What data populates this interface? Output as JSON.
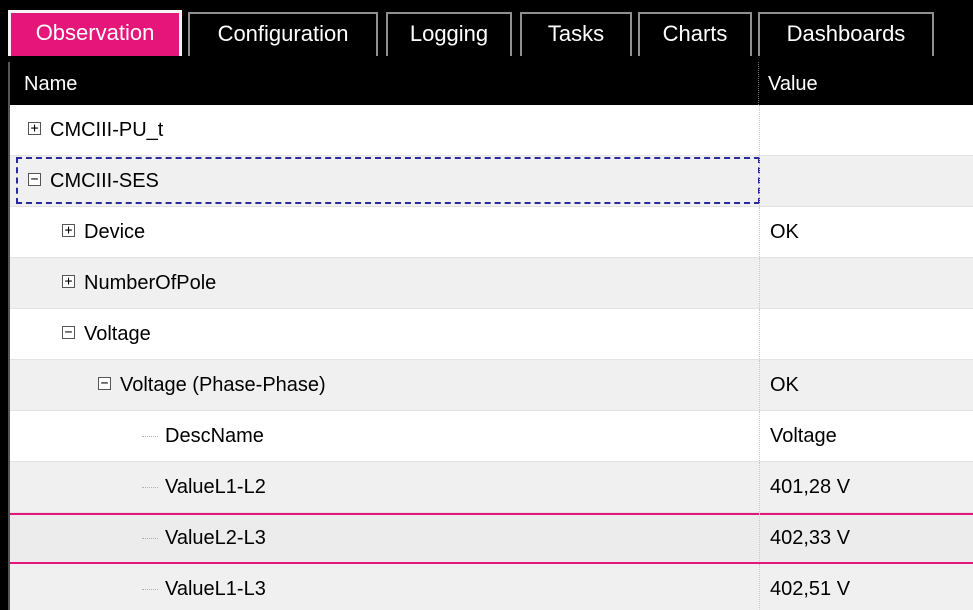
{
  "tabs": [
    {
      "label": "Observation",
      "active": true
    },
    {
      "label": "Configuration",
      "active": false
    },
    {
      "label": "Logging",
      "active": false
    },
    {
      "label": "Tasks",
      "active": false
    },
    {
      "label": "Charts",
      "active": false
    },
    {
      "label": "Dashboards",
      "active": false
    }
  ],
  "columns": {
    "name": "Name",
    "value": "Value"
  },
  "rows": [
    {
      "name": "CMCIII-PU_t",
      "value": "",
      "expander": "+"
    },
    {
      "name": "CMCIII-SES",
      "value": "",
      "expander": "−",
      "focused": true
    },
    {
      "name": "Device",
      "value": "OK",
      "expander": "+"
    },
    {
      "name": "NumberOfPole",
      "value": "",
      "expander": "+"
    },
    {
      "name": "Voltage",
      "value": "",
      "expander": "−"
    },
    {
      "name": "Voltage (Phase-Phase)",
      "value": "OK",
      "expander": "−"
    },
    {
      "name": "DescName",
      "value": "Voltage",
      "expander": ""
    },
    {
      "name": "ValueL1-L2",
      "value": "401,28 V",
      "expander": ""
    },
    {
      "name": "ValueL2-L3",
      "value": "402,33 V",
      "expander": "",
      "selected": true
    },
    {
      "name": "ValueL1-L3",
      "value": "402,51 V",
      "expander": ""
    }
  ],
  "colors": {
    "accent": "#e5157a",
    "focus": "#2a2a9a"
  },
  "icons": {
    "expand": "plus-box-icon",
    "collapse": "minus-box-icon"
  }
}
